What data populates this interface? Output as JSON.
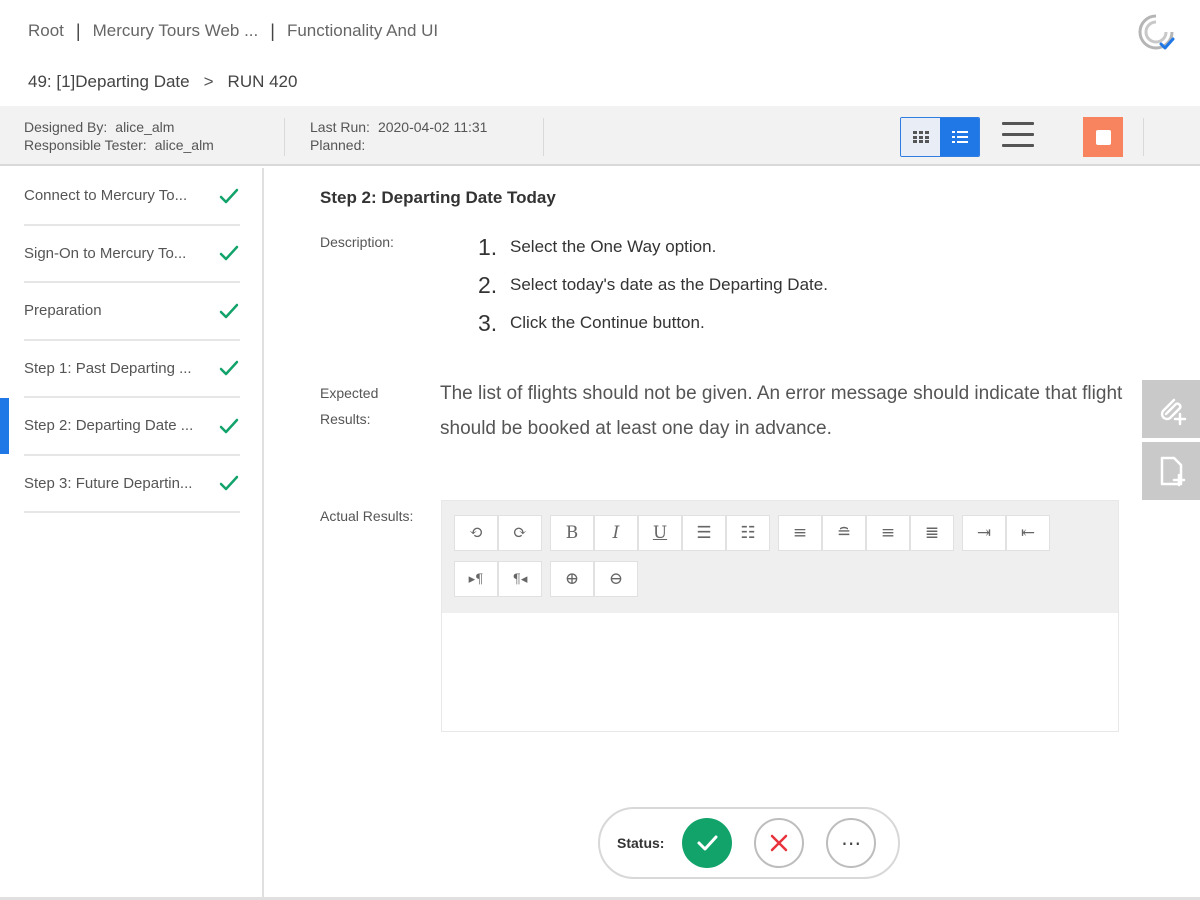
{
  "breadcrumb": {
    "items": [
      "Root",
      "Mercury Tours Web ...",
      "Functionality And UI"
    ],
    "separator": "|"
  },
  "run": {
    "test_label": "49:  [1]Departing Date",
    "arrow": ">",
    "run_label": "RUN 420"
  },
  "info": {
    "designed_by_label": "Designed By:",
    "designed_by_value": "alice_alm",
    "responsible_label": "Responsible Tester:",
    "responsible_value": "alice_alm",
    "last_run_label": "Last Run:",
    "last_run_value": "2020-04-02 11:31",
    "planned_label": "Planned:"
  },
  "steps": [
    {
      "label": "Connect to Mercury To...",
      "status": "passed"
    },
    {
      "label": "Sign-On to Mercury To...",
      "status": "passed"
    },
    {
      "label": "Preparation",
      "status": "passed"
    },
    {
      "label": "Step 1: Past Departing ...",
      "status": "passed"
    },
    {
      "label": "Step 2: Departing Date ...",
      "status": "passed",
      "active": true
    },
    {
      "label": "Step 3: Future Departin...",
      "status": "passed"
    }
  ],
  "detail": {
    "heading": "Step 2: Departing Date Today",
    "description_label": "Description:",
    "description_steps": [
      {
        "num": "1.",
        "text": "Select the One Way option."
      },
      {
        "num": "2.",
        "text": "Select today's date as the Departing Date."
      },
      {
        "num": "3.",
        "text": "Click the Continue button."
      }
    ],
    "expected_label_1": "Expected",
    "expected_label_2": "Results:",
    "expected_text": "The list of flights should not be given. An error message should indicate that flight should be booked at least one day in advance.",
    "actual_label": "Actual Results:"
  },
  "toolbar": {
    "row1": [
      [
        "⟲",
        "⟳"
      ],
      [
        "B",
        "I",
        "U",
        "☰",
        "☷"
      ],
      [
        "≡",
        "≘",
        "≡",
        "≣"
      ],
      [
        "⇥",
        "⇤"
      ]
    ],
    "row2": [
      [
        "▸¶",
        "¶◂"
      ],
      [
        "⊕",
        "⊖"
      ]
    ]
  },
  "status": {
    "label": "Status:",
    "more": "⋯"
  },
  "colors": {
    "accent": "#1f78e6",
    "pass": "#12a36b",
    "fail": "#e8323c",
    "stop": "#f7845e"
  }
}
